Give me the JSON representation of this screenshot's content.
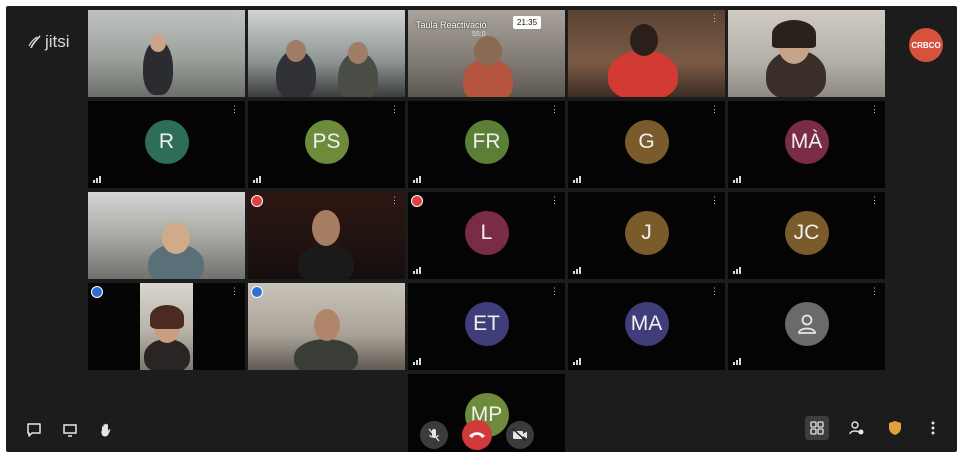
{
  "app": {
    "logo_text": "jitsi",
    "self_avatar_text": "CRBCO"
  },
  "recording_overlay": {
    "title": "Taula Reactivació",
    "timer": "21:35",
    "subtitle": "55:0"
  },
  "tiles": [
    {
      "type": "video",
      "name": ""
    },
    {
      "type": "video",
      "name": ""
    },
    {
      "type": "video",
      "name": ""
    },
    {
      "type": "video",
      "name": ""
    },
    {
      "type": "video",
      "name": ""
    },
    {
      "type": "avatar",
      "initials": "R",
      "color": "#2f6e56"
    },
    {
      "type": "avatar",
      "initials": "PS",
      "color": "#6d8b3a"
    },
    {
      "type": "avatar",
      "initials": "FR",
      "color": "#5b7f36"
    },
    {
      "type": "avatar",
      "initials": "G",
      "color": "#7b5a2c"
    },
    {
      "type": "avatar",
      "initials": "MÀ",
      "color": "#7a2b46"
    },
    {
      "type": "avatar",
      "initials": "L",
      "color": "#7a2b46"
    },
    {
      "type": "avatar",
      "initials": "J",
      "color": "#7b5a2c"
    },
    {
      "type": "avatar",
      "initials": "JC",
      "color": "#7b5a2c"
    },
    {
      "type": "avatar",
      "initials": "ET",
      "color": "#3f3d7a"
    },
    {
      "type": "avatar",
      "initials": "MA",
      "color": "#3f3d7a"
    },
    {
      "type": "avatar",
      "initials": "",
      "color": "#6a6a6a"
    },
    {
      "type": "avatar",
      "initials": "MP",
      "color": "#6d8b3a"
    }
  ],
  "toolbar": {
    "left": [
      "chat-icon",
      "screenshare-icon",
      "raise-hand-icon"
    ],
    "center": [
      "microphone-icon",
      "hangup-icon",
      "camera-icon"
    ],
    "right": [
      "tile-view-icon",
      "participants-icon",
      "security-icon",
      "more-icon"
    ]
  },
  "colors": {
    "background": "#1c1c1c",
    "hangup": "#d13a3a",
    "active_speaker": "#2f6fd1"
  }
}
